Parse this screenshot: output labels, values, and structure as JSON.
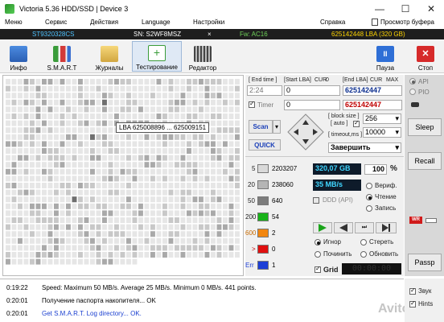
{
  "window": {
    "title": "Victoria 5.36 HDD/SSD | Device 3",
    "minimize_icon": "minimize-icon",
    "maximize_icon": "maximize-icon",
    "close_icon": "close-icon"
  },
  "menu": {
    "items": [
      "Меню",
      "Сервис",
      "Действия",
      "Language",
      "Настройки",
      "Справка"
    ],
    "clipboard_view": "Просмотр буфера"
  },
  "strip": {
    "model": "ST9320328CS",
    "serial": "SN: S2WF8MSZ",
    "close_mark": "×",
    "firmware": "Fw: AC16",
    "capacity": "625142448 LBA (320 GB)"
  },
  "toolbar": {
    "buttons": [
      "Инфо",
      "S.M.A.R.T",
      "Журналы",
      "Тестирование",
      "Редактор"
    ],
    "pause": "Пауза",
    "stop": "Стоп"
  },
  "map": {
    "tooltip": "LBA  625008896 ... 625009151"
  },
  "controls": {
    "end_time_label": "[ End time ]",
    "end_time_value": "2:24",
    "start_lba_label": "[Start LBA]",
    "cur_label": "CUR",
    "zero": "0",
    "end_lba_label": "[End LBA]",
    "max_label": "MAX",
    "start_lba_value": "0",
    "end_lba_value": "625142447",
    "current_lba_value": "625142447",
    "timer_label": "Timer",
    "timer_value": "0",
    "scan_button": "Scan",
    "quick_button": "QUICK",
    "block_size_label": "[ block size ]",
    "auto_label": "[ auto ]",
    "block_size_value": "256",
    "timeout_label": "[ timeout,ms ]",
    "timeout_value": "10000",
    "finish_select": "Завершить"
  },
  "stats": [
    {
      "threshold": "5",
      "count": "2203207",
      "color": "#d9d9d9"
    },
    {
      "threshold": "20",
      "count": "238060",
      "color": "#b5b5b5"
    },
    {
      "threshold": "50",
      "count": "640",
      "color": "#7c7c7c"
    },
    {
      "threshold": "200",
      "count": "54",
      "color": "#19b31a"
    },
    {
      "threshold": "600",
      "count": "2",
      "color": "#f2860f"
    },
    {
      "threshold": ">",
      "count": "0",
      "color": "#e01010"
    },
    {
      "threshold": "Err",
      "count": "1",
      "color": "#1d3fd6"
    }
  ],
  "readout": {
    "position": "320,07 GB",
    "percent": "100",
    "percent_sign": "%",
    "speed": "35 MB/s",
    "ddd_api": "DDD (API)",
    "verify": "Вериф.",
    "read": "Чтение",
    "write": "Запись"
  },
  "actions": {
    "ignore": "Игнор",
    "erase": "Стереть",
    "repair": "Починить",
    "refresh": "Обновить",
    "grid": "Grid",
    "grid_timer": "00:00:00"
  },
  "side": {
    "api": "API",
    "pio": "PIO",
    "sleep": "Sleep",
    "recall": "Recall",
    "wr": "WR",
    "passp": "Passp",
    "sound": "Звук",
    "hints": "Hints"
  },
  "log": [
    {
      "time": "0:19:22",
      "text": "Speed: Maximum 50 MB/s. Average 25 MB/s. Minimum 0 MB/s. 441 points.",
      "color": "#000000"
    },
    {
      "time": "0:20:01",
      "text": "Получение паспорта накопителя... OK",
      "color": "#000000"
    },
    {
      "time": "0:20:01",
      "text": "Get S.M.A.R.T. Log directory... OK.",
      "color": "#1a3fd0"
    }
  ],
  "watermark": "Avito"
}
